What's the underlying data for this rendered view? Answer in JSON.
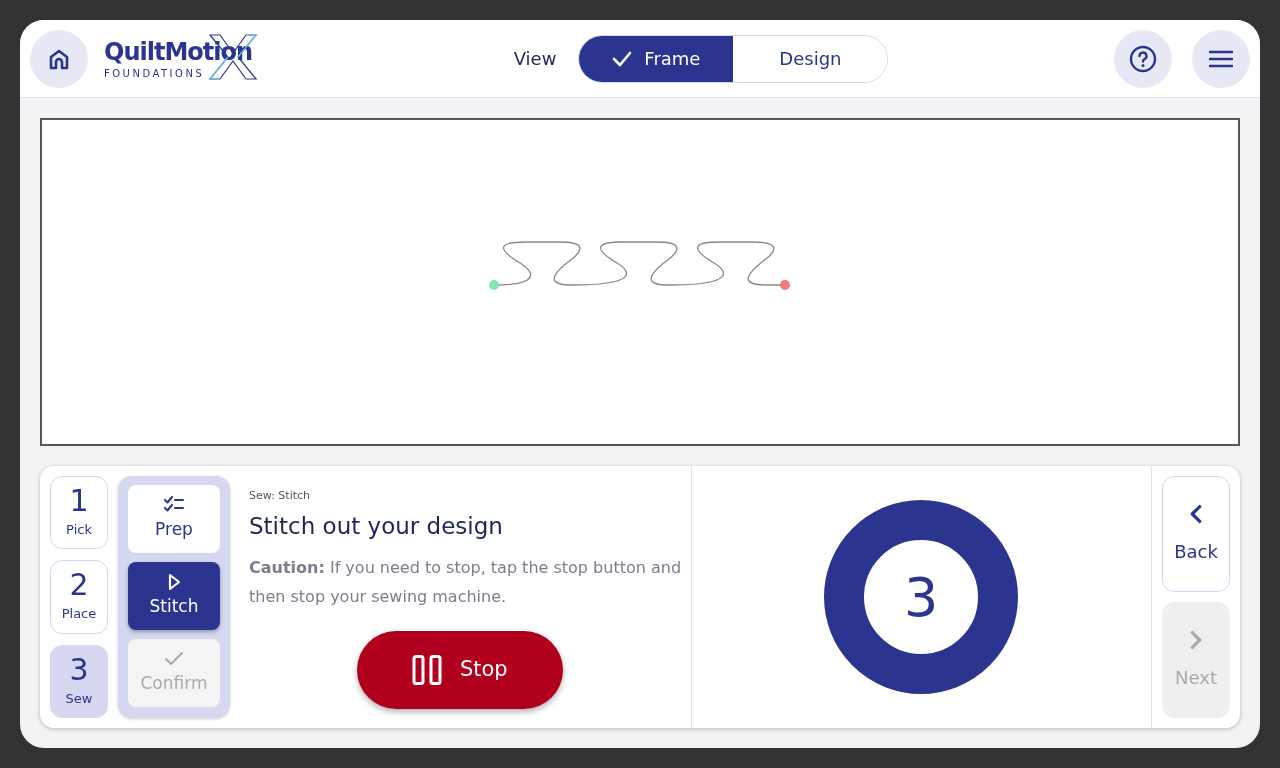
{
  "header": {
    "logo": {
      "name": "QuiltMotion",
      "tagline": "FOUNDATIONS"
    },
    "view": {
      "label": "View",
      "options": [
        {
          "label": "Frame",
          "selected": true
        },
        {
          "label": "Design",
          "selected": false
        }
      ]
    }
  },
  "steps": [
    {
      "number": "1",
      "label": "Pick",
      "selected": false
    },
    {
      "number": "2",
      "label": "Place",
      "selected": false
    },
    {
      "number": "3",
      "label": "Sew",
      "selected": true
    }
  ],
  "substeps": [
    {
      "label": "Prep",
      "kind": "prep",
      "selected": false,
      "disabled": false
    },
    {
      "label": "Stitch",
      "kind": "stitch",
      "selected": true,
      "disabled": false
    },
    {
      "label": "Confirm",
      "kind": "confirm",
      "selected": false,
      "disabled": true
    }
  ],
  "instruction": {
    "breadcrumb": "Sew: Stitch",
    "title": "Stitch out your design",
    "caution": "**Caution:** If you need to stop, tap the stop button and then stop your sewing machine."
  },
  "stop_button": {
    "label": "Stop"
  },
  "countdown": {
    "value": "3"
  },
  "nav": [
    {
      "label": "Back",
      "kind": "back",
      "disabled": false
    },
    {
      "label": "Next",
      "kind": "next",
      "disabled": true
    }
  ]
}
